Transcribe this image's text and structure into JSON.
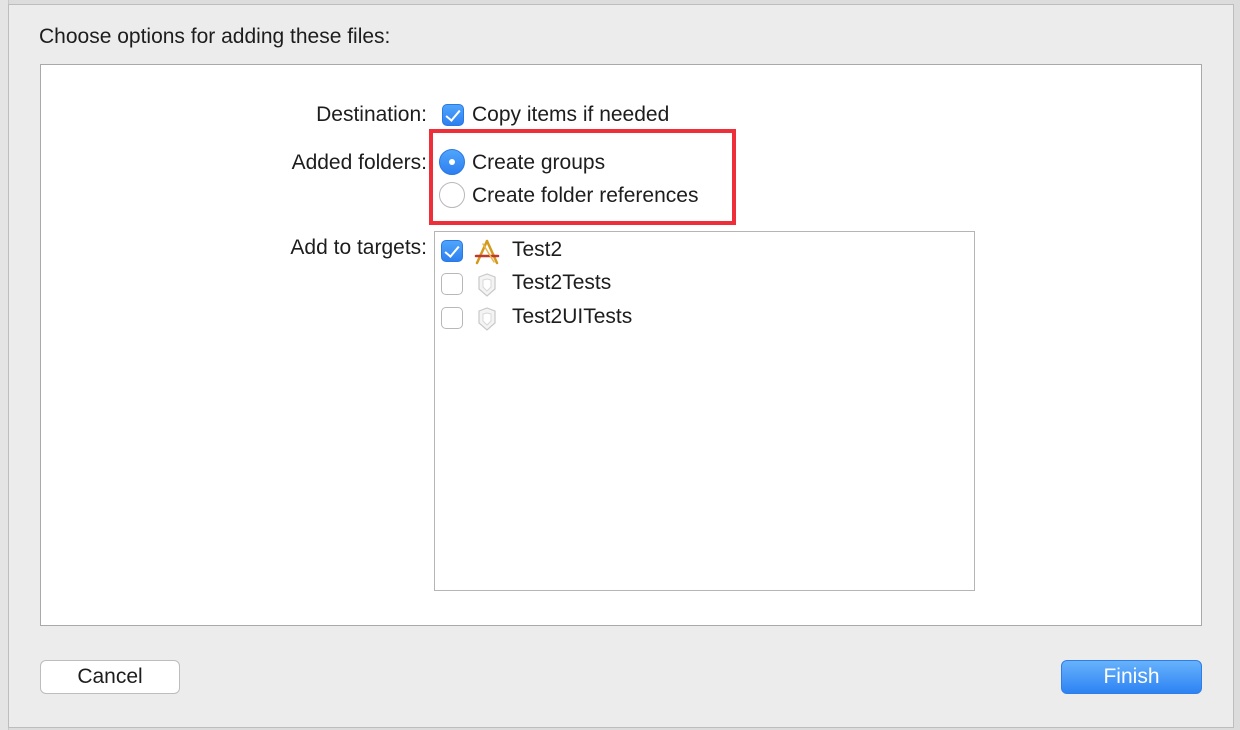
{
  "dialog": {
    "title": "Choose options for adding these files:"
  },
  "destination": {
    "label": "Destination:",
    "checkbox_label": "Copy items if needed",
    "checked": true
  },
  "added_folders": {
    "label": "Added folders:",
    "options": [
      {
        "label": "Create groups",
        "selected": true
      },
      {
        "label": "Create folder references",
        "selected": false
      }
    ]
  },
  "targets": {
    "label": "Add to targets:",
    "items": [
      {
        "name": "Test2",
        "checked": true,
        "icon": "app-target-icon"
      },
      {
        "name": "Test2Tests",
        "checked": false,
        "icon": "test-bundle-icon"
      },
      {
        "name": "Test2UITests",
        "checked": false,
        "icon": "test-bundle-icon"
      }
    ]
  },
  "buttons": {
    "cancel": "Cancel",
    "finish": "Finish"
  },
  "colors": {
    "accent": "#2e7ff0",
    "highlight": "#ee2f3a"
  }
}
